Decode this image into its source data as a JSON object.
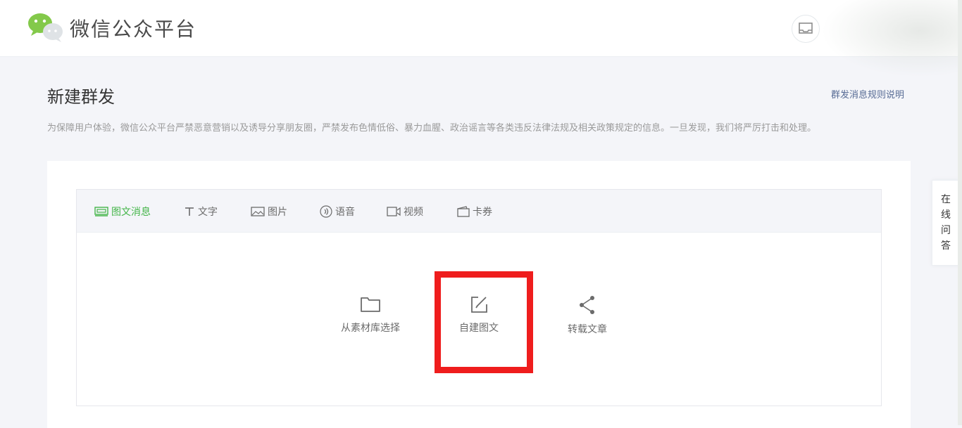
{
  "header": {
    "brand": "微信公众平台",
    "icons": {
      "logo": "wechat-logo-icon",
      "mail": "mail-icon"
    }
  },
  "page": {
    "title": "新建群发",
    "rules_link": "群发消息规则说明",
    "notice": "为保障用户体验，微信公众平台严禁恶意营销以及诱导分享朋友圈，严禁发布色情低俗、暴力血腥、政治谣言等各类违反法律法规及相关政策规定的信息。一旦发现，我们将严厉打击和处理。"
  },
  "tabs": [
    {
      "label": "图文消息",
      "icon": "news-icon",
      "active": true
    },
    {
      "label": "文字",
      "icon": "text-icon",
      "active": false
    },
    {
      "label": "图片",
      "icon": "image-icon",
      "active": false
    },
    {
      "label": "语音",
      "icon": "voice-icon",
      "active": false
    },
    {
      "label": "视频",
      "icon": "video-icon",
      "active": false
    },
    {
      "label": "卡券",
      "icon": "card-icon",
      "active": false
    }
  ],
  "actions": [
    {
      "label": "从素材库选择",
      "icon": "folder-icon"
    },
    {
      "label": "自建图文",
      "icon": "edit-icon"
    },
    {
      "label": "转载文章",
      "icon": "share-icon"
    }
  ],
  "side_qa": {
    "label": "在线问答"
  },
  "colors": {
    "accent": "#44b549",
    "link": "#576b95",
    "highlight": "#ef1d1d",
    "background": "#f4f5f9"
  }
}
